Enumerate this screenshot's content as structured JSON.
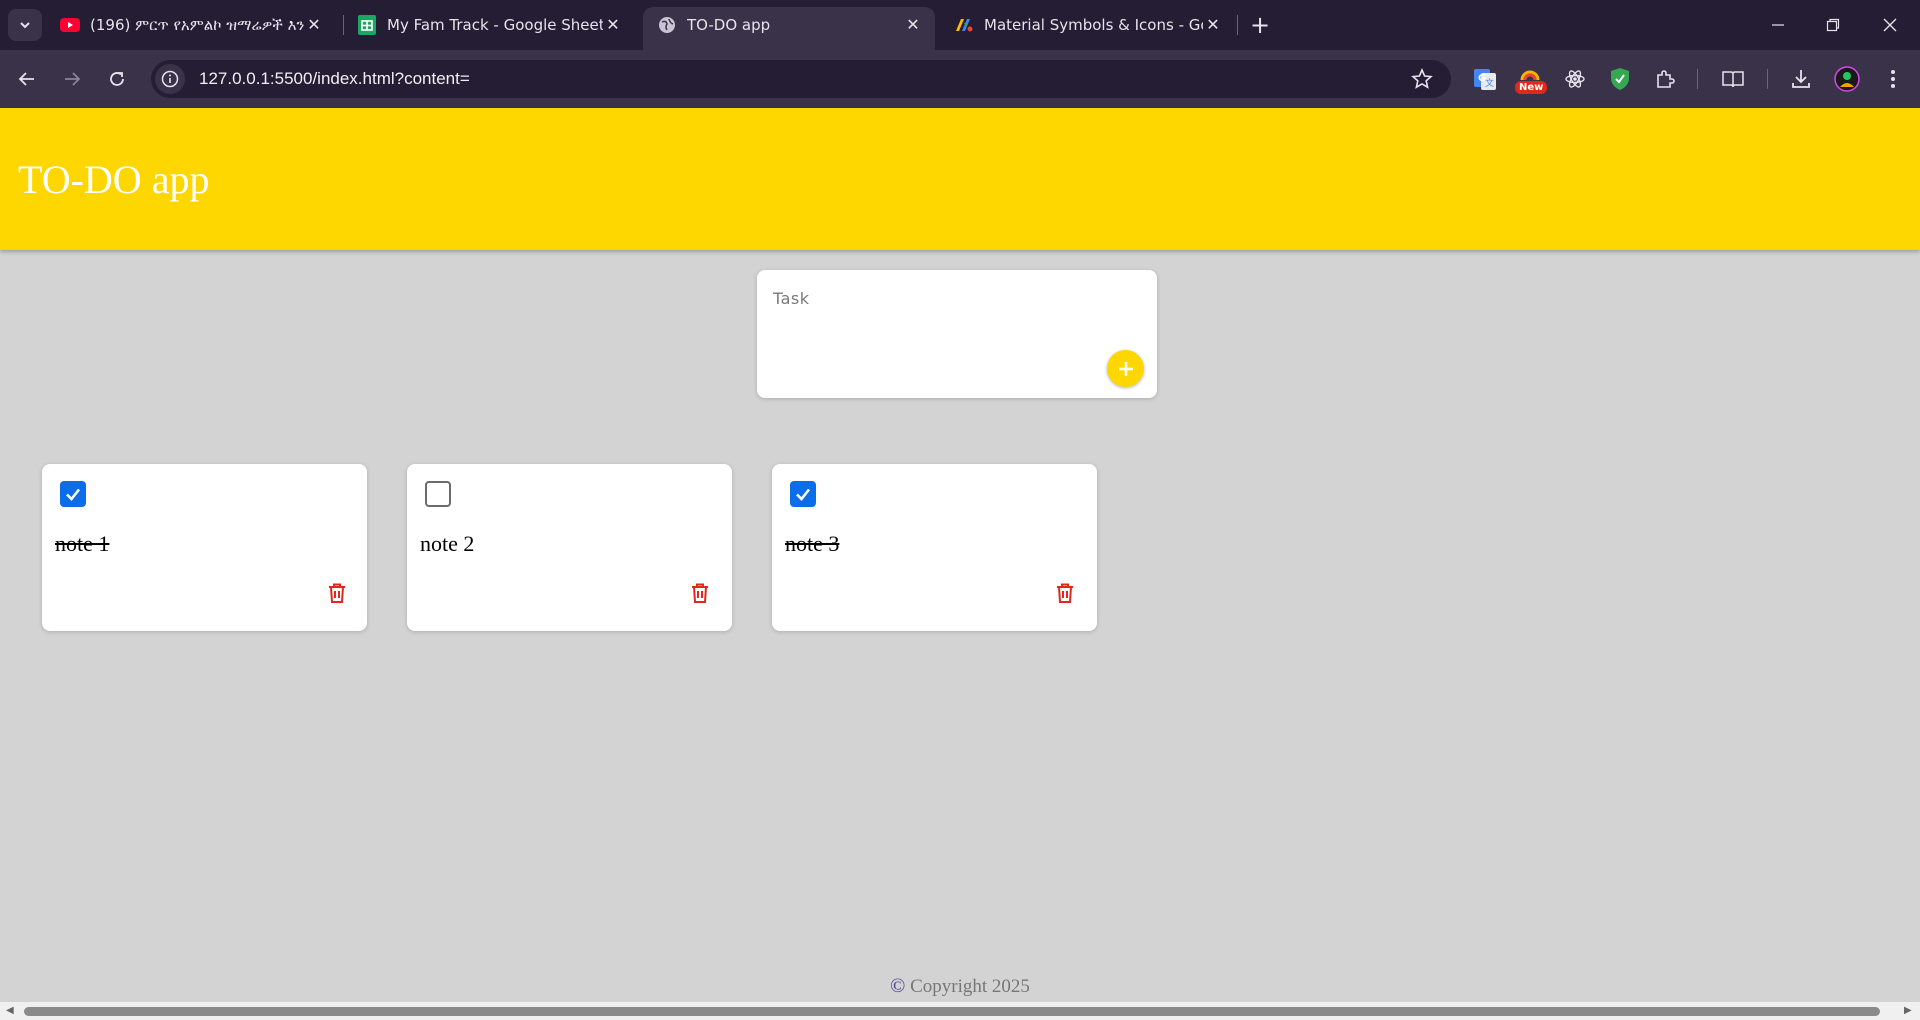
{
  "browser": {
    "tabs": [
      {
        "title": "(196) ምርጥ የአምልኮ ዝማሬዎች እንዲ",
        "icon": "youtube-icon",
        "active": false
      },
      {
        "title": "My Fam Track - Google Sheets",
        "icon": "google-sheets-icon",
        "active": false
      },
      {
        "title": "TO-DO app",
        "icon": "globe-icon",
        "active": true
      },
      {
        "title": "Material Symbols & Icons - Goo",
        "icon": "google-fonts-icon",
        "active": false
      }
    ],
    "new_tab_label": "+",
    "url": "127.0.0.1:5500/index.html?content=",
    "extension_badge": "New",
    "colors": {
      "tabstrip": "#241d33",
      "toolbar": "#3a3249",
      "omnibox": "#241d33"
    }
  },
  "app": {
    "title": "TO-DO app",
    "header_color": "#ffd700",
    "task_input": {
      "placeholder": "Task",
      "value": ""
    },
    "add_button_icon": "plus-icon",
    "notes": [
      {
        "text": "note 1",
        "checked": true
      },
      {
        "text": "note 2",
        "checked": false
      },
      {
        "text": "note 3",
        "checked": true
      }
    ],
    "delete_icon": "trash-icon",
    "delete_color": "#e0281e",
    "checkbox_color": "#0b6ee8",
    "footer": {
      "symbol": "©",
      "text": "Copyright 2025"
    }
  }
}
